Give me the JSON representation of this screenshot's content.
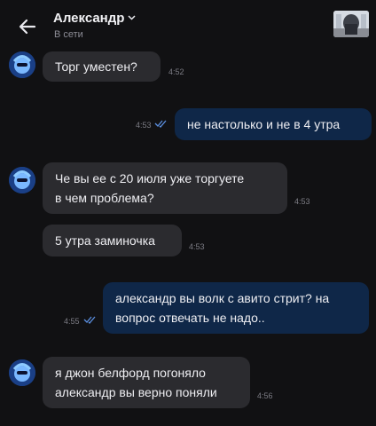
{
  "header": {
    "contact_name": "Александр",
    "status": "В сети"
  },
  "colors": {
    "background": "#111113",
    "incoming_bubble": "#2b2b2f",
    "outgoing_bubble": "#0f2748",
    "read_ticks": "#5b8fe0"
  },
  "messages": [
    {
      "direction": "in",
      "text": "Торг уместен?",
      "time": "4:52"
    },
    {
      "direction": "out",
      "text": "не настолько и не в 4 утра",
      "time": "4:53",
      "read": true
    },
    {
      "direction": "in",
      "lines": [
        "Че вы ее с 20 июля уже торгуете",
        "в чем проблема?"
      ],
      "time": "4:53"
    },
    {
      "direction": "in",
      "text": "5 утра заминочка",
      "time": "4:53"
    },
    {
      "direction": "out",
      "lines": [
        "александр вы волк с авито стрит? на",
        "вопрос отвечать не надо.."
      ],
      "time": "4:55",
      "read": true
    },
    {
      "direction": "in",
      "lines": [
        "я джон белфорд погоняло",
        "александр вы верно поняли"
      ],
      "time": "4:56"
    }
  ]
}
